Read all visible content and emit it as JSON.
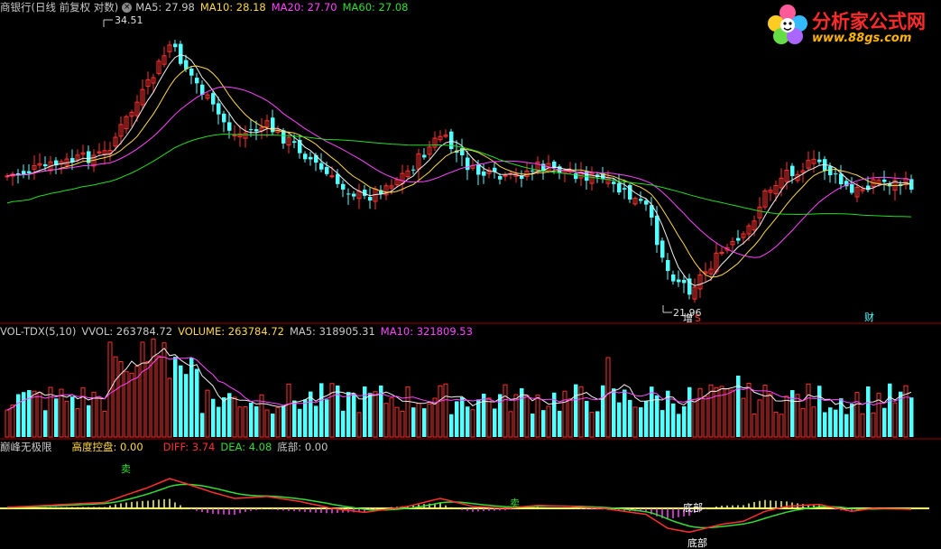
{
  "window": {
    "title": "商银行(日线 前复权 对数)",
    "ma_icon": "×"
  },
  "main_panel": {
    "labels": {
      "ma5": "MA5: 27.98",
      "ma10": "MA10: 28.18",
      "ma20": "MA20: 27.70",
      "ma60": "MA60: 27.08"
    },
    "high_marker": "34.51",
    "low_marker": "21.96",
    "event_markers": [
      "增",
      "S",
      "财"
    ],
    "colors": {
      "up": "#ff3030",
      "down": "#54ffff",
      "ma5": "#f0f0f0",
      "ma10": "#ffd84a",
      "ma20": "#ff44ff",
      "ma60": "#22dd22"
    }
  },
  "volume_panel": {
    "labels": {
      "name": "VOL-TDX(5,10)",
      "vvol": "VVOL: 263784.72",
      "volume": "VOLUME: 263784.72",
      "ma5": "MA5: 318905.31",
      "ma10": "MA10: 321809.53"
    }
  },
  "indicator_panel": {
    "labels": {
      "name": "巅峰无极限",
      "gaodu": "高度控盘: 0.00",
      "diff": "DIFF: 3.74",
      "dea": "DEA: 4.08",
      "dibu": "底部: 0.00"
    },
    "annotations": [
      "卖",
      "卖",
      "底部",
      "底部"
    ]
  },
  "logo": {
    "title": "分析家公式网",
    "url": "www.88gs.com"
  }
}
